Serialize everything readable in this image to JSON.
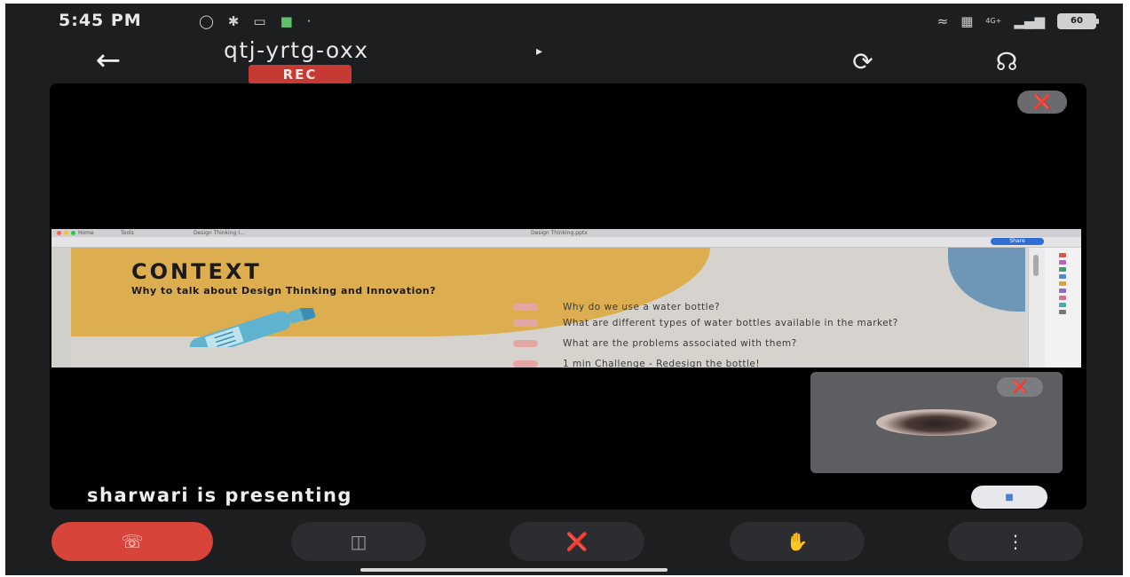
{
  "status_bar": {
    "time": "5:45 PM",
    "icons_left": [
      "headphones-icon",
      "settings-icon",
      "laptop-icon",
      "app-icon",
      "dot-icon"
    ],
    "icons_right": [
      "wifi-icon",
      "volte-icon",
      "signal-icon",
      "battery-icon"
    ],
    "network": "4G+",
    "battery": "60"
  },
  "header": {
    "meeting_code": "qtj-yrtg-oxx",
    "arrow": "▸",
    "rec_label": "REC"
  },
  "shared_slide": {
    "heading": "CONTEXT",
    "subheading": "Why to talk about Design Thinking and Innovation?",
    "items": [
      "Why do we use a water bottle?",
      "What are different types of water bottles available in the market?",
      "What are the problems associated with them?",
      "1 min Challenge - Redesign the bottle!"
    ],
    "window": {
      "tab_home": "Home",
      "tab_tools": "Tools",
      "tab_doc": "Design Thinking I...",
      "doc_title": "Design Thinking.pptx",
      "share_label": "Share"
    },
    "colors": {
      "yellow": "#dcae4f",
      "blue": "#6e97b7",
      "dots": "#e2a7a3"
    }
  },
  "stage": {
    "presenting_text": "sharwari is presenting"
  },
  "controls": {
    "end_call": "end-call-icon",
    "camera": "camera-off-icon",
    "mic": "mic-off-icon",
    "raise_hand": "raise-hand-icon",
    "more": "more-vert-icon"
  },
  "colors": {
    "background": "#1d1e20",
    "end_call": "#d8443a",
    "rec": "#c53a32"
  }
}
